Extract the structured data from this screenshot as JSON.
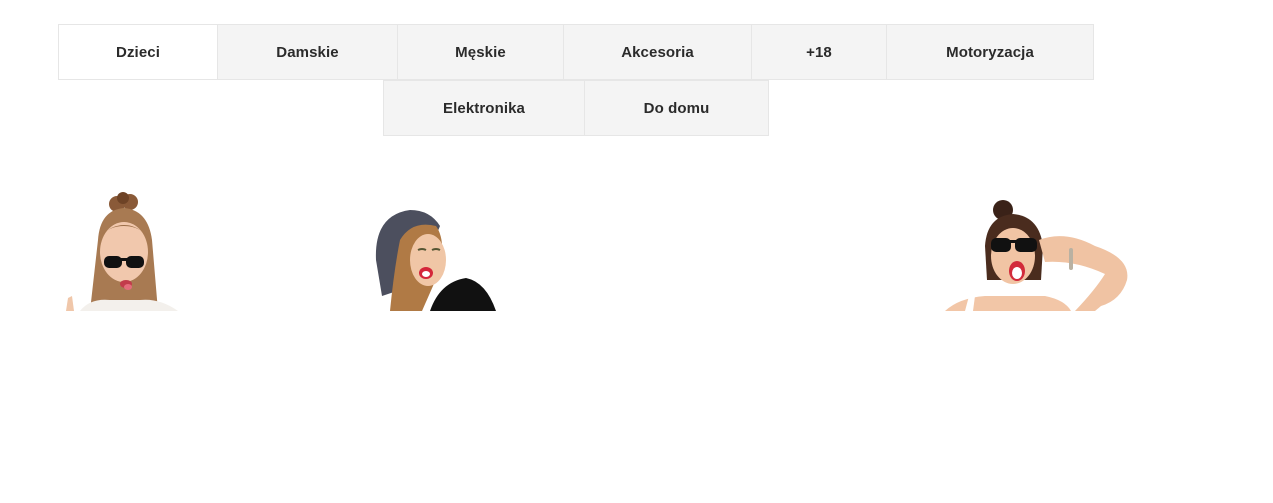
{
  "category_tabs": {
    "row1": [
      {
        "label": "Dzieci",
        "active": true
      },
      {
        "label": "Damskie",
        "active": false
      },
      {
        "label": "Męskie",
        "active": false
      },
      {
        "label": "Akcesoria",
        "active": false
      },
      {
        "label": "+18",
        "active": false
      },
      {
        "label": "Motoryzacja",
        "active": false
      }
    ],
    "row2": [
      {
        "label": "Elektronika",
        "active": false
      },
      {
        "label": "Do domu",
        "active": false
      }
    ]
  },
  "colors": {
    "tab_background": "#f4f4f4",
    "tab_active_background": "#ffffff",
    "tab_border": "#e6e6e6",
    "tab_text": "#2b2b2b"
  }
}
